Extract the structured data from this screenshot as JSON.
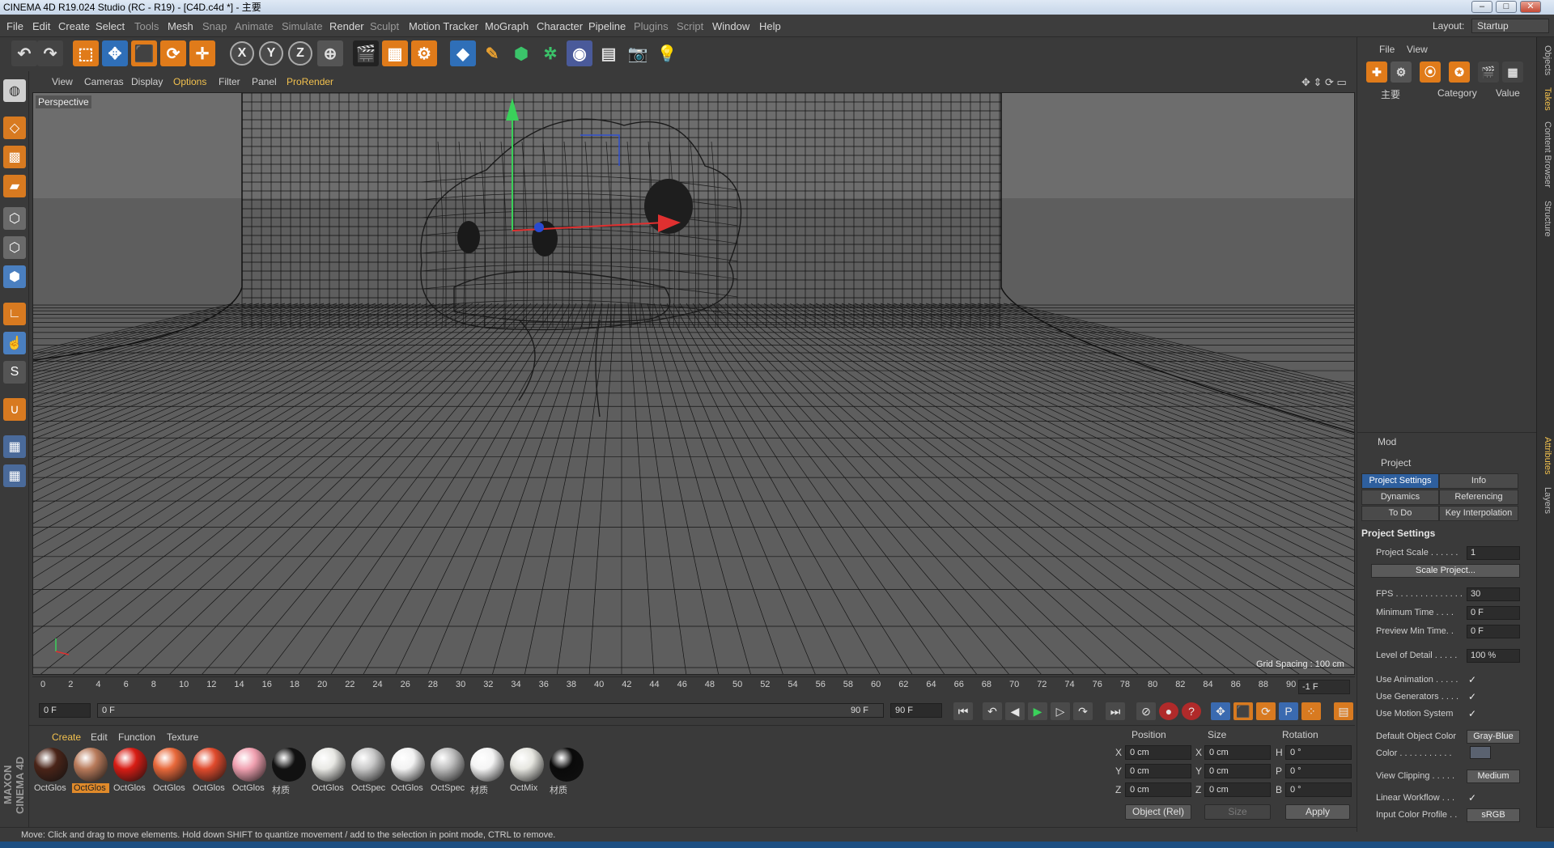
{
  "window": {
    "title": "CINEMA 4D R19.024 Studio (RC - R19) - [C4D.c4d *] - 主要",
    "controls": [
      "–",
      "□",
      "✕"
    ]
  },
  "menu": {
    "items": [
      "File",
      "Edit",
      "Create",
      "Select",
      "Tools",
      "Mesh",
      "Snap",
      "Animate",
      "Simulate",
      "Render",
      "Sculpt",
      "Motion Tracker",
      "MoGraph",
      "Character",
      "Pipeline",
      "Plugins",
      "Script",
      "Window",
      "Help"
    ],
    "layout_label": "Layout:",
    "layout_value": "Startup"
  },
  "toolbar": {
    "axis_x": "X",
    "axis_y": "Y",
    "axis_z": "Z"
  },
  "viewport": {
    "menu": [
      "View",
      "Cameras",
      "Display",
      "Options",
      "Filter",
      "Panel",
      "ProRender"
    ],
    "label": "Perspective",
    "grid_spacing": "Grid Spacing : 100 cm"
  },
  "timeline": {
    "ticks": [
      "0",
      "2",
      "4",
      "6",
      "8",
      "10",
      "12",
      "14",
      "16",
      "18",
      "20",
      "22",
      "24",
      "26",
      "28",
      "30",
      "32",
      "34",
      "36",
      "38",
      "40",
      "42",
      "44",
      "46",
      "48",
      "50",
      "52",
      "54",
      "56",
      "58",
      "60",
      "62",
      "64",
      "66",
      "68",
      "70",
      "72",
      "74",
      "76",
      "78",
      "80",
      "82",
      "84",
      "86",
      "88",
      "90"
    ],
    "current_frame": "-1 F"
  },
  "transport": {
    "start": "0 F",
    "range_start": "0 F",
    "range_end": "90 F",
    "end": "90 F"
  },
  "materials": {
    "menu": [
      "Create",
      "Edit",
      "Function",
      "Texture"
    ],
    "items": [
      {
        "label": "OctGlos",
        "color": "#4a2418"
      },
      {
        "label": "OctGlos",
        "color": "#b87a5a"
      },
      {
        "label": "OctGlos",
        "color": "#d81c14"
      },
      {
        "label": "OctGlos",
        "color": "#e8683a"
      },
      {
        "label": "OctGlos",
        "color": "#e04a2c"
      },
      {
        "label": "OctGlos",
        "color": "#f0a0b0"
      },
      {
        "label": "材质",
        "color": "#111111"
      },
      {
        "label": "OctGlos",
        "color": "#e8e8e4"
      },
      {
        "label": "OctSpec",
        "color": "#c8c8c8"
      },
      {
        "label": "OctGlos",
        "color": "#f2f2f2"
      },
      {
        "label": "OctSpec",
        "color": "#bdbdbd"
      },
      {
        "label": "材质",
        "color": "#f4f4f4"
      },
      {
        "label": "OctMix",
        "color": "#e6e6e0"
      },
      {
        "label": "材质",
        "color": "#0a0a0a"
      }
    ],
    "brand": "MAXON CINEMA 4D"
  },
  "coords": {
    "headers": [
      "Position",
      "Size",
      "Rotation"
    ],
    "rows": [
      {
        "axis": "X",
        "pos": "0 cm",
        "size_axis": "X",
        "size": "0 cm",
        "rot_axis": "H",
        "rot": "0 °"
      },
      {
        "axis": "Y",
        "pos": "0 cm",
        "size_axis": "Y",
        "size": "0 cm",
        "rot_axis": "P",
        "rot": "0 °"
      },
      {
        "axis": "Z",
        "pos": "0 cm",
        "size_axis": "Z",
        "size": "0 cm",
        "rot_axis": "B",
        "rot": "0 °"
      }
    ],
    "mode": "Object (Rel)",
    "size_mode": "Size",
    "apply": "Apply"
  },
  "status": "Move: Click and drag to move elements. Hold down SHIFT to quantize movement / add to the selection in point mode, CTRL to remove.",
  "objects": {
    "menu": [
      "File",
      "View"
    ],
    "col_name": "主要",
    "col_category": "Category",
    "col_value": "Value"
  },
  "attributes": {
    "mode": "Mod",
    "object": "Project",
    "tabs": [
      "Project Settings",
      "Info",
      "Dynamics",
      "Referencing",
      "To Do",
      "Key Interpolation"
    ],
    "section": "Project Settings",
    "project_scale_label": "Project Scale . . . . . .",
    "project_scale": "1",
    "scale_project": "Scale Project...",
    "fps_label": "FPS . . . . . . . . . . . . . .",
    "fps": "30",
    "min_time_label": "Minimum Time . . . .",
    "min_time": "0 F",
    "preview_min_label": "Preview Min Time. .",
    "preview_min": "0 F",
    "lod_label": "Level of Detail . . . . .",
    "lod": "100 %",
    "use_anim_label": "Use Animation . . . . .",
    "use_gen_label": "Use Generators . . . .",
    "use_motion_label": "Use Motion System",
    "check": "✓",
    "def_color_label": "Default Object Color",
    "def_color": "Gray-Blue",
    "color_label": "Color . . . . . . . . . . .",
    "view_clip_label": "View Clipping . . . . .",
    "view_clip": "Medium",
    "linear_wf_label": "Linear Workflow . . .",
    "input_profile_label": "Input Color Profile . .",
    "input_profile": "sRGB"
  },
  "side_tabs": [
    "Objects",
    "Takes",
    "Content Browser",
    "Structure",
    "Attributes",
    "Layers"
  ]
}
